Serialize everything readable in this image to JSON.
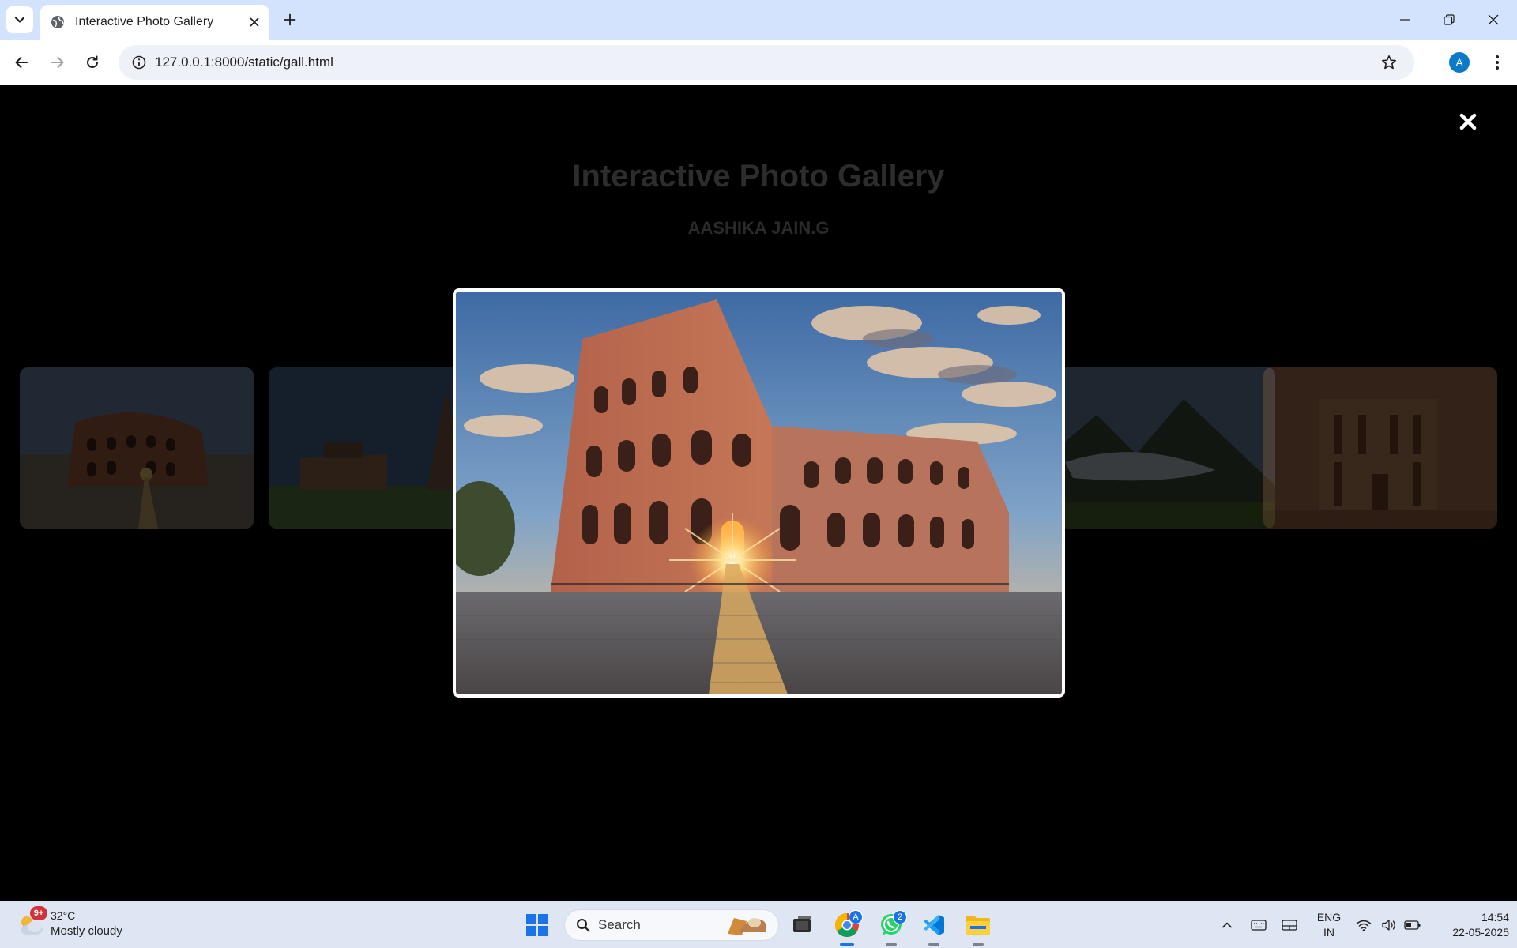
{
  "browser": {
    "tab_title": "Interactive Photo Gallery",
    "url": "127.0.0.1:8000/static/gall.html",
    "profile_initial": "A"
  },
  "page": {
    "title": "Interactive Photo Gallery",
    "subtitle": "AASHIKA JAIN.G",
    "lightbox_close": "✖"
  },
  "gallery": {
    "thumbnails": [
      {
        "name": "colosseum"
      },
      {
        "name": "temple"
      },
      {
        "name": "machu-picchu"
      },
      {
        "name": "petra"
      }
    ],
    "open_image": "colosseum"
  },
  "taskbar": {
    "weather_temp": "32°C",
    "weather_cond": "Mostly cloudy",
    "weather_badge": "9+",
    "search_label": "Search",
    "chrome_badge": "A",
    "whatsapp_badge": "2",
    "lang_line1": "ENG",
    "lang_line2": "IN",
    "time": "14:54",
    "date": "22-05-2025"
  },
  "colors": {
    "tabstrip": "#d3e3fd",
    "page_background": "#000000",
    "taskbar": "#dfe6f3",
    "accent": "#1a73e8"
  }
}
